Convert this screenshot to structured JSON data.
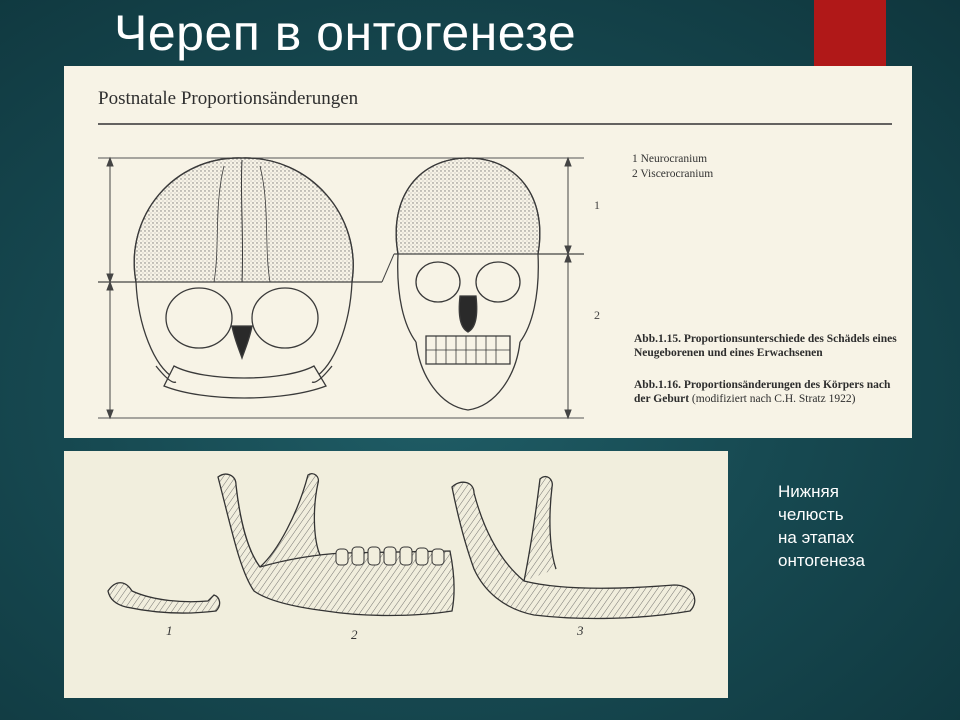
{
  "slide": {
    "title": "Череп в онтогенезе",
    "accent_color": "#b01818",
    "background_color": "#174a52"
  },
  "top_figure": {
    "heading": "Postnatale Proportionsänderungen",
    "legend": [
      "1  Neurocranium",
      "2  Viscerocranium"
    ],
    "scale_labels": [
      "1",
      "2"
    ],
    "caption_1_title": "Abb.1.15.",
    "caption_1_text": "Proportionsunterschiede des Schädels eines Neugeborenen und eines Erwachsenen",
    "caption_2_title": "Abb.1.16.",
    "caption_2_text": "Proportionsänderungen des Körpers nach der Geburt",
    "caption_2_source": "(modifiziert nach C.H. Stratz 1922)"
  },
  "bottom_figure": {
    "stage_labels": [
      "1",
      "2",
      "3"
    ]
  },
  "side_text": [
    "Нижняя",
    "челюсть",
    "на этапах",
    "онтогенеза"
  ]
}
